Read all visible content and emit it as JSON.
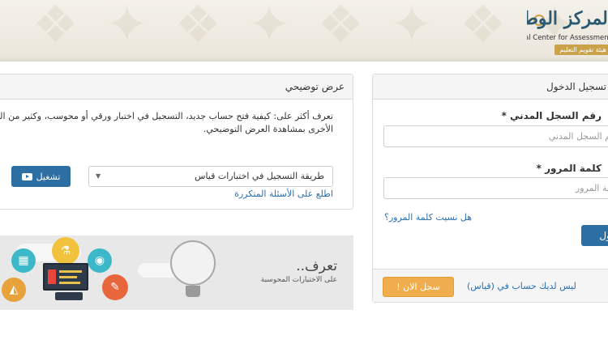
{
  "header": {
    "logo_arabic": "المركز الوطني للقياس",
    "logo_english": "National Center for Assessment",
    "logo_tagline": "هيئة تقويم التعليم"
  },
  "login": {
    "title": "تسجيل الدخول",
    "civil_label": "رقم السجل المدني *",
    "civil_placeholder": "رقم السجل المدني",
    "password_label": "كلمة المرور *",
    "password_placeholder": "كلمة المرور",
    "forgot_link": "هل نسيت كلمة المرور؟",
    "login_button": "دخول",
    "no_account_text": "ليس لديك حساب في (قياس)",
    "register_button": "سجل الان !"
  },
  "demo": {
    "title": "عرض توضيحي",
    "description_line1": "تعرف أكثر على: كيفية فتح حساب جديد، التسجيل في اختبار ورقي أو محوسب، وكثير من المعلومات",
    "description_line2": "الأخرى بمشاهدة العرض التوضيحي.",
    "select_value": "طريقة التسجيل في اختبارات قياس",
    "play_button": "تشغيل",
    "faq_link": "اطلع على الأسئلة المتكررة"
  },
  "banner": {
    "title": "تعرف..",
    "subtitle": "على الاختبارات المحوسبة"
  },
  "colors": {
    "primary": "#2d6ea3",
    "warning": "#f0ad4e",
    "link": "#2a6fb0",
    "logo": "#2a5a72",
    "gold": "#c9a24a"
  }
}
